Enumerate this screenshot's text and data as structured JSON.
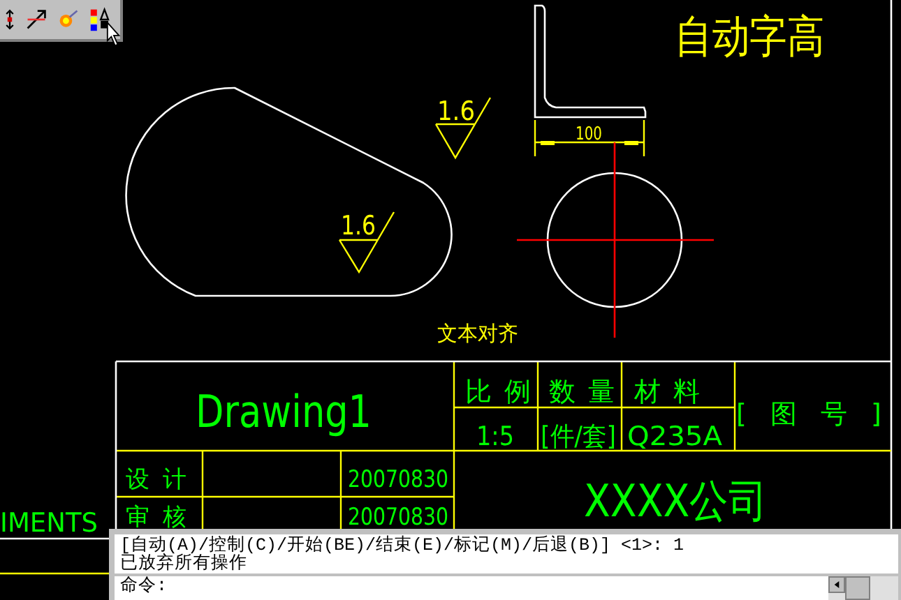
{
  "drawing": {
    "annotations": [
      {
        "kind": "heading",
        "text": "自动字高"
      },
      {
        "kind": "roughness",
        "text": "1.6"
      },
      {
        "kind": "roughness",
        "text": "1.6"
      },
      {
        "kind": "dimension",
        "text": "100"
      },
      {
        "kind": "note",
        "text": "文本对齐"
      }
    ]
  },
  "title_block": {
    "drawing_name": "Drawing1",
    "headers": [
      "比 例",
      "数 量",
      "材 料"
    ],
    "values": [
      "1:5",
      "[件/套]",
      "Q235A"
    ],
    "drawing_number": "[ 图 号 ]",
    "rows": [
      {
        "label": "设 计",
        "date": "20070830"
      },
      {
        "label": "审 核",
        "date": "20070830"
      }
    ],
    "company": "XXXX公司"
  },
  "side_text": "IMENTS",
  "command_window": {
    "history": [
      "[自动(A)/控制(C)/开始(BE)/结束(E)/标记(M)/后退(B)] <1>: 1",
      "已放弃所有操作"
    ],
    "prompt": "命令:"
  }
}
